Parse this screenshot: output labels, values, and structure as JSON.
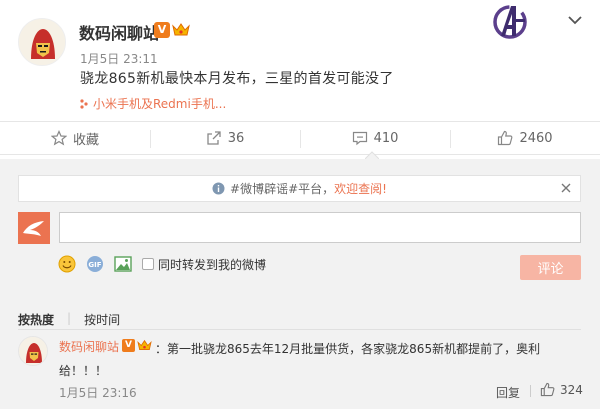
{
  "post": {
    "author": "数码闲聊站",
    "verified_badge": "V",
    "time": "1月5日 23:11",
    "text": "骁龙865新机最快本月发布，三星的首发可能没了",
    "topic_link": "小米手机及Redmi手机..."
  },
  "actions": {
    "favorite_label": "收藏",
    "repost_count": "36",
    "comment_count": "410",
    "like_count": "2460"
  },
  "comment_box": {
    "notice_prefix": "#微博辟谣#平台，",
    "notice_link": "欢迎查阅!",
    "input_value": "",
    "repost_checkbox_label": "同时转发到我的微博",
    "submit_label": "评论"
  },
  "sort": {
    "by_hot": "按热度",
    "by_time": "按时间"
  },
  "comments": [
    {
      "author": "数码闲聊站",
      "verified_badge": "V",
      "text_line1": "：第一批骁龙865去年12月批量供货，各家骁龙865新机都提前了，奥利",
      "text_line2": "给！！！",
      "time": "1月5日 23:16",
      "reply_label": "回复",
      "likes": "324"
    }
  ],
  "colors": {
    "accent": "#eb7350",
    "verified": "#ef7c1c",
    "submit_disabled": "#f7b5a4",
    "panel_bg": "#f2f2f2"
  },
  "icons": [
    "iron-man-avatar",
    "verified-v-icon",
    "crown-icon",
    "avengers-logo",
    "chevron-down-icon",
    "topic-dots-icon",
    "star-icon",
    "share-icon",
    "comment-icon",
    "thumbs-up-icon",
    "info-icon",
    "close-icon",
    "weibo-avatar",
    "emoji-icon",
    "gif-icon",
    "image-icon"
  ]
}
